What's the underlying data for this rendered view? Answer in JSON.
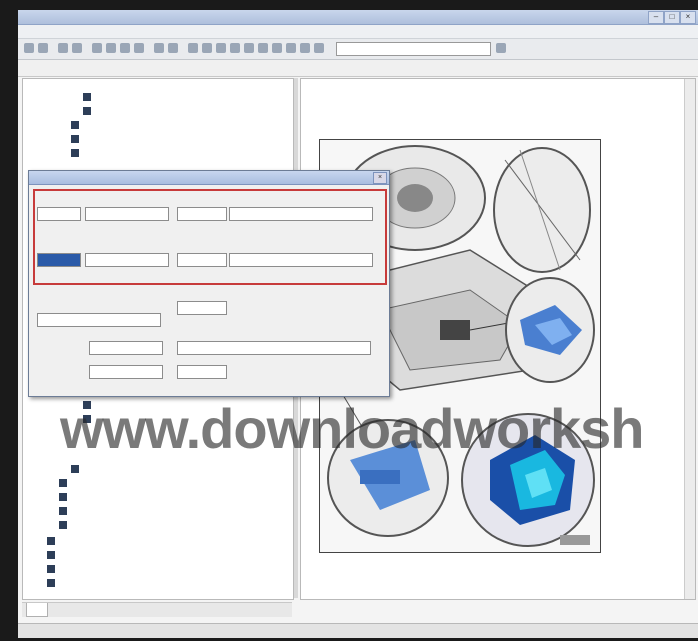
{
  "window": {
    "title": "",
    "min_label": "–",
    "max_label": "□",
    "close_label": "×"
  },
  "menubar": {
    "items": []
  },
  "toolbar": {
    "combo_value": ""
  },
  "addressbar": {
    "left_text": "",
    "right_text": ""
  },
  "tree": {
    "items": []
  },
  "document": {
    "title": "",
    "subtitle": "",
    "caption_lines": []
  },
  "dialog": {
    "title": "",
    "close_label": "×",
    "fields": []
  },
  "watermark": {
    "text": "www.downloadworksh"
  },
  "tabs": {
    "active": ""
  },
  "status": {
    "left": "",
    "mid1": "",
    "mid2": "",
    "right": ""
  }
}
